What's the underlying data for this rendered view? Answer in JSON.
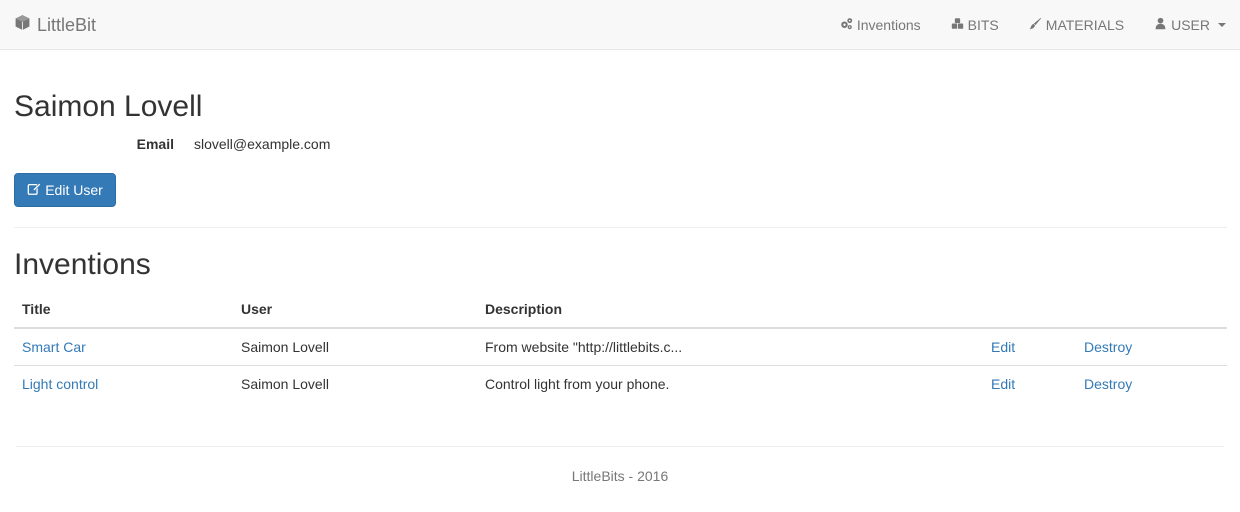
{
  "navbar": {
    "brand": "LittleBit",
    "brand_icon": "cube-icon",
    "items": [
      {
        "label": "Inventions",
        "icon": "gears-icon"
      },
      {
        "label": "BITS",
        "icon": "cubes-icon"
      },
      {
        "label": "MATERIALS",
        "icon": "paint-brush-icon"
      },
      {
        "label": "USER",
        "icon": "user-icon"
      }
    ]
  },
  "profile": {
    "name": "Saimon Lovell",
    "email_label": "Email",
    "email_value": "slovell@example.com",
    "edit_button": "Edit User"
  },
  "inventions": {
    "heading": "Inventions",
    "columns": [
      "Title",
      "User",
      "Description",
      "",
      ""
    ],
    "rows": [
      {
        "title": "Smart Car",
        "user": "Saimon Lovell",
        "description": "From website \"http://littlebits.c...",
        "edit": "Edit",
        "destroy": "Destroy"
      },
      {
        "title": "Light control",
        "user": "Saimon Lovell",
        "description": "Control light from your phone.",
        "edit": "Edit",
        "destroy": "Destroy"
      }
    ]
  },
  "footer": {
    "text": "LittleBits - 2016"
  },
  "colors": {
    "link": "#337ab7",
    "primary_button": "#337ab7",
    "navbar_bg": "#f8f8f8",
    "nav_text": "#777777"
  }
}
